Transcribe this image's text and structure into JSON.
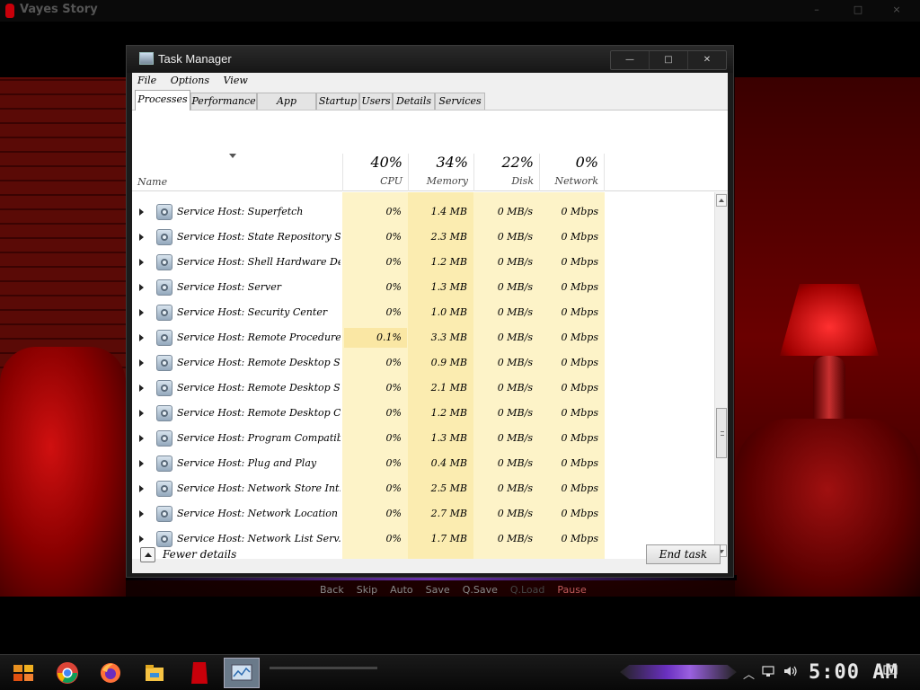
{
  "game_window": {
    "title": "Vayes Story",
    "quick_menu": [
      {
        "label": "Back",
        "state": "normal"
      },
      {
        "label": "Skip",
        "state": "normal"
      },
      {
        "label": "Auto",
        "state": "normal"
      },
      {
        "label": "Save",
        "state": "normal"
      },
      {
        "label": "Q.Save",
        "state": "normal"
      },
      {
        "label": "Q.Load",
        "state": "disabled"
      },
      {
        "label": "Pause",
        "state": "active"
      }
    ]
  },
  "task_manager": {
    "title": "Task Manager",
    "menu": [
      "File",
      "Options",
      "View"
    ],
    "tabs": [
      "Processes",
      "Performance",
      "App history",
      "Startup",
      "Users",
      "Details",
      "Services"
    ],
    "selected_tab": "Processes",
    "columns": {
      "name": "Name",
      "cpu": {
        "pct": "40%",
        "label": "CPU"
      },
      "memory": {
        "pct": "34%",
        "label": "Memory"
      },
      "disk": {
        "pct": "22%",
        "label": "Disk"
      },
      "network": {
        "pct": "0%",
        "label": "Network"
      }
    },
    "processes": [
      {
        "name": "Service Host: Superfetch",
        "cpu": "0%",
        "memory": "1.4 MB",
        "disk": "0 MB/s",
        "network": "0 Mbps"
      },
      {
        "name": "Service Host: State Repository S...",
        "cpu": "0%",
        "memory": "2.3 MB",
        "disk": "0 MB/s",
        "network": "0 Mbps"
      },
      {
        "name": "Service Host: Shell Hardware De...",
        "cpu": "0%",
        "memory": "1.2 MB",
        "disk": "0 MB/s",
        "network": "0 Mbps"
      },
      {
        "name": "Service Host: Server",
        "cpu": "0%",
        "memory": "1.3 MB",
        "disk": "0 MB/s",
        "network": "0 Mbps"
      },
      {
        "name": "Service Host: Security Center",
        "cpu": "0%",
        "memory": "1.0 MB",
        "disk": "0 MB/s",
        "network": "0 Mbps"
      },
      {
        "name": "Service Host: Remote Procedure ...",
        "cpu": "0.1%",
        "memory": "3.3 MB",
        "disk": "0 MB/s",
        "network": "0 Mbps"
      },
      {
        "name": "Service Host: Remote Desktop S...",
        "cpu": "0%",
        "memory": "0.9 MB",
        "disk": "0 MB/s",
        "network": "0 Mbps"
      },
      {
        "name": "Service Host: Remote Desktop S...",
        "cpu": "0%",
        "memory": "2.1 MB",
        "disk": "0 MB/s",
        "network": "0 Mbps"
      },
      {
        "name": "Service Host: Remote Desktop Co...",
        "cpu": "0%",
        "memory": "1.2 MB",
        "disk": "0 MB/s",
        "network": "0 Mbps"
      },
      {
        "name": "Service Host: Program Compatibi...",
        "cpu": "0%",
        "memory": "1.3 MB",
        "disk": "0 MB/s",
        "network": "0 Mbps"
      },
      {
        "name": "Service Host: Plug and Play",
        "cpu": "0%",
        "memory": "0.4 MB",
        "disk": "0 MB/s",
        "network": "0 Mbps"
      },
      {
        "name": "Service Host: Network Store Int...",
        "cpu": "0%",
        "memory": "2.5 MB",
        "disk": "0 MB/s",
        "network": "0 Mbps"
      },
      {
        "name": "Service Host: Network Location ...",
        "cpu": "0%",
        "memory": "2.7 MB",
        "disk": "0 MB/s",
        "network": "0 Mbps"
      },
      {
        "name": "Service Host: Network List Serv...",
        "cpu": "0%",
        "memory": "1.7 MB",
        "disk": "0 MB/s",
        "network": "0 Mbps"
      }
    ],
    "footer": {
      "fewer_details": "Fewer details",
      "end_task": "End task"
    },
    "heat_colors": {
      "cpu": "#fdf3c8",
      "memory": "#fbecb0",
      "disk": "#fdf3c8",
      "network": "#fdf3c8",
      "highlight": "#fae7a4"
    }
  },
  "taskbar": {
    "clock": "5:00 AM",
    "pinned": [
      "start-icon",
      "chrome-icon",
      "firefox-icon",
      "file-explorer-icon",
      "game-icon",
      "task-manager-icon"
    ]
  }
}
